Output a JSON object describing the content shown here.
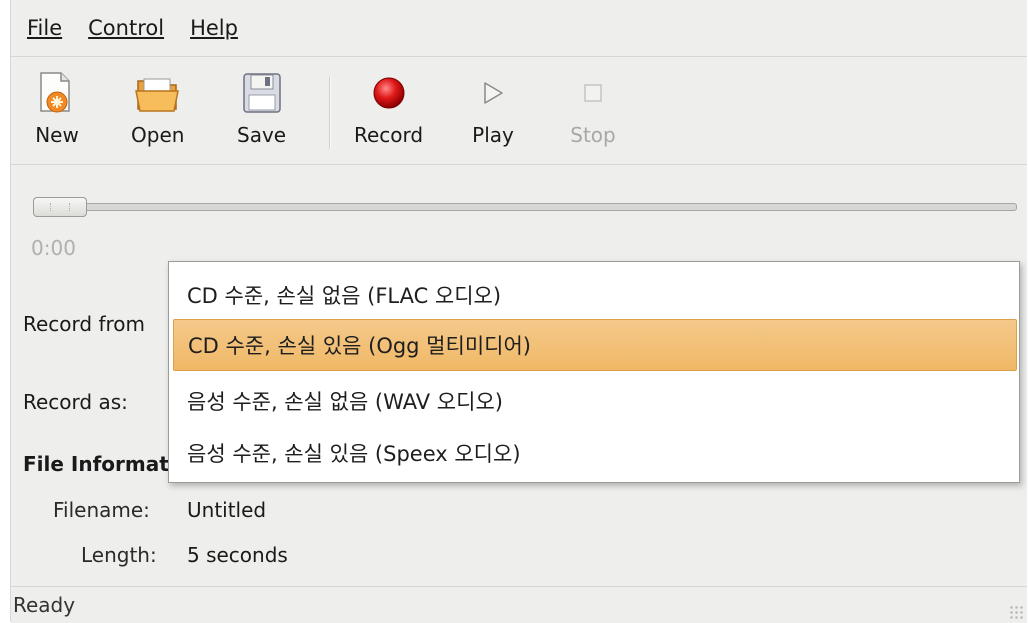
{
  "menubar": {
    "file": "File",
    "control": "Control",
    "help": "Help"
  },
  "toolbar": {
    "new": "New",
    "open": "Open",
    "save": "Save",
    "record": "Record",
    "play": "Play",
    "stop": "Stop"
  },
  "position": {
    "time": "0:00",
    "slider_fraction": 0
  },
  "form": {
    "record_from_label": "Record from",
    "record_as_label": "Record as:"
  },
  "file_info": {
    "title": "File Informat",
    "filename_label": "Filename:",
    "filename_value": "Untitled",
    "length_label": "Length:",
    "length_value": "5 seconds"
  },
  "dropdown": {
    "options": [
      "CD 수준, 손실 없음 (FLAC 오디오)",
      "CD 수준, 손실 있음 (Ogg 멀티미디어)",
      "음성 수준, 손실 없음 (WAV 오디오)",
      "음성 수준, 손실 있음 (Speex 오디오)"
    ],
    "selected_index": 1
  },
  "status": {
    "text": "Ready"
  },
  "colors": {
    "highlight": "#f0bb6c",
    "record_red": "#d41010",
    "window_bg": "#eeeeec"
  },
  "icons": {
    "new": "new-document-icon",
    "open": "open-folder-icon",
    "save": "floppy-disk-icon",
    "record": "record-icon",
    "play": "play-icon",
    "stop": "stop-icon"
  }
}
